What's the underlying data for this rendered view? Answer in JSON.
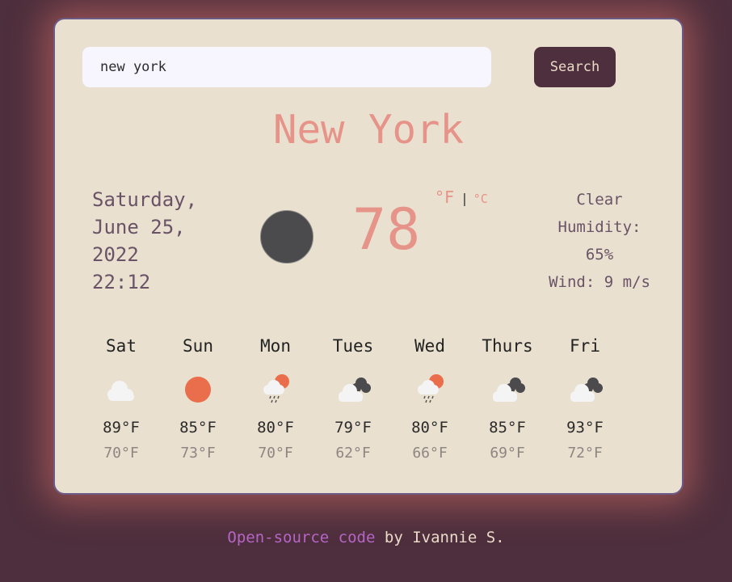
{
  "search": {
    "value": "new york",
    "button_label": "Search"
  },
  "city": "New York",
  "date": {
    "line1": "Saturday,",
    "line2": "June 25,",
    "line3": "2022",
    "time": "22:12"
  },
  "current": {
    "icon": "moon-icon",
    "temperature": "78",
    "unit_f": "°F",
    "separator": "|",
    "unit_c": "°C",
    "description": "Clear",
    "humidity_label": "Humidity:",
    "humidity_value": "65%",
    "wind": "Wind: 9 m/s"
  },
  "forecast": [
    {
      "day": "Sat",
      "icon": "cloud-icon",
      "high": "89°F",
      "low": "70°F"
    },
    {
      "day": "Sun",
      "icon": "sun-icon",
      "high": "85°F",
      "low": "73°F"
    },
    {
      "day": "Mon",
      "icon": "rain-sun-icon",
      "high": "80°F",
      "low": "70°F"
    },
    {
      "day": "Tues",
      "icon": "dark-clouds-icon",
      "high": "79°F",
      "low": "62°F"
    },
    {
      "day": "Wed",
      "icon": "rain-sun-icon",
      "high": "80°F",
      "low": "66°F"
    },
    {
      "day": "Thurs",
      "icon": "dark-clouds-icon",
      "high": "85°F",
      "low": "69°F"
    },
    {
      "day": "Fri",
      "icon": "dark-clouds-icon",
      "high": "93°F",
      "low": "72°F"
    }
  ],
  "footer": {
    "link_text": "Open-source code",
    "suffix": " by Ivannie S."
  },
  "colors": {
    "background": "#4e2f3d",
    "card": "#e9e0cf",
    "accent": "#e69389",
    "link": "#b565c6"
  }
}
